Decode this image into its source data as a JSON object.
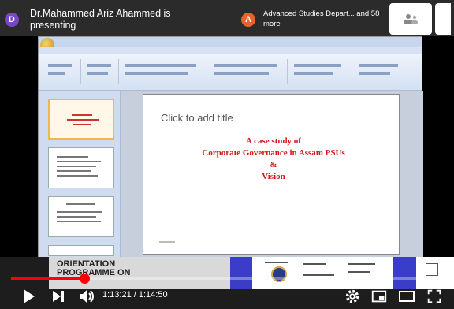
{
  "meeting": {
    "presenter_initial": "D",
    "presenter_text": "Dr.Mahammed Ariz Ahammed is presenting",
    "participant_initial": "A",
    "participant_text": "Advanced Studies Depart... and 58 more"
  },
  "slide": {
    "title_placeholder": "Click to add title",
    "body_lines": [
      "A case study of",
      "Corporate Governance in Assam PSUs",
      "&",
      "Vision"
    ]
  },
  "banner": {
    "line1": "ORIENTATION",
    "line2": "PROGRAMME ON"
  },
  "player": {
    "time": "1:13:21 / 1:14:50",
    "progress_fraction": 0.17
  },
  "colors": {
    "accent": "#ff0000",
    "slide_text": "#d11a1a"
  },
  "icons": [
    "play-icon",
    "next-icon",
    "volume-icon",
    "settings-icon",
    "miniplayer-icon",
    "theater-icon",
    "fullscreen-icon"
  ]
}
